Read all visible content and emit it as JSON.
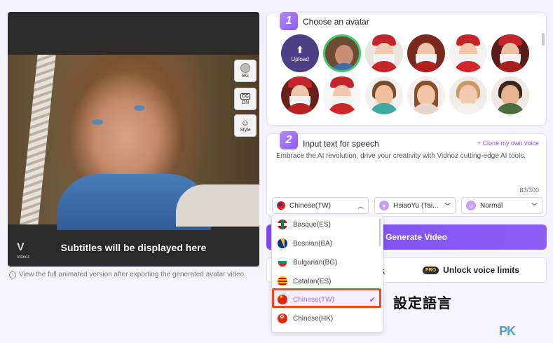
{
  "preview": {
    "subtitle": "Subtitles will be displayed here",
    "watermark": "Vidnoz",
    "buttons": [
      {
        "label": "BG"
      },
      {
        "label": "ON",
        "icon_text": "CC"
      },
      {
        "label": "Style"
      }
    ],
    "note": "View the full animated version after exporting the generated avatar video."
  },
  "step1": {
    "number": "1",
    "title": "Choose an avatar",
    "upload_label": "Upload"
  },
  "step2": {
    "number": "2",
    "title": "Input text for speech",
    "clone_link": "+ Clone my own voice",
    "text": "Embrace the AI revolution, drive your creativity with Vidnoz cutting-edge AI tools.",
    "char_count": "83/300",
    "language": "Chinese(TW)",
    "voice": "HsiaoYu (Tai...",
    "speed": "Normal"
  },
  "actions": {
    "generate": "Generate Video",
    "watermark_partial": "ark",
    "pro_badge": "PRO",
    "unlock": "Unlock voice limits"
  },
  "dropdown": {
    "items": [
      {
        "label": "Basque(ES)"
      },
      {
        "label": "Bosnian(BA)"
      },
      {
        "label": "Bulgarian(BG)"
      },
      {
        "label": "Catalan(ES)"
      },
      {
        "label": "Chinese(TW)",
        "selected": true
      },
      {
        "label": "Chinese(HK)"
      }
    ]
  },
  "annotation": "設定語言",
  "site_logo": "PK",
  "colors": {
    "accent": "#8a5cf0",
    "highlight": "#ef4b1c"
  }
}
